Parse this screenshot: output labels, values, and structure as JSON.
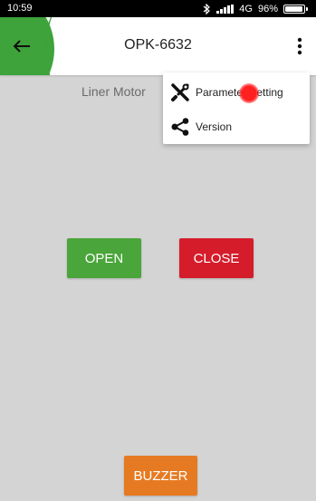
{
  "status_bar": {
    "time": "10:59",
    "network": "4G",
    "battery_text": "96%",
    "battery_level": 0.96,
    "icons": [
      "bluetooth-icon",
      "signal-icon",
      "battery-icon"
    ]
  },
  "app_bar": {
    "title": "OPK-6632",
    "accent_color": "#3da33a"
  },
  "main": {
    "section_label": "Liner Motor",
    "open_label": "OPEN",
    "close_label": "CLOSE",
    "buzzer_label": "BUZZER",
    "colors": {
      "background": "#d4d4d4",
      "open": "#4aa53a",
      "close": "#d51c2b",
      "buzzer": "#e67a22"
    }
  },
  "menu": {
    "items": [
      {
        "label": "Parameter Setting",
        "icon": "tools-icon"
      },
      {
        "label": "Version",
        "icon": "share-icon"
      }
    ]
  }
}
